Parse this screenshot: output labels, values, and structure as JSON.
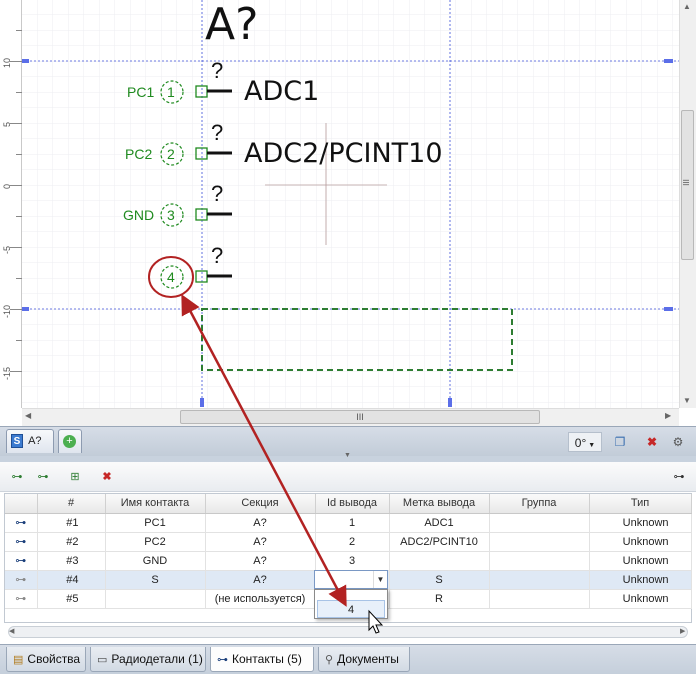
{
  "schematic": {
    "designator": "A?",
    "pins": [
      {
        "net": "PC1",
        "number": "1",
        "name": "ADC1",
        "label": "?"
      },
      {
        "net": "PC2",
        "number": "2",
        "name": "ADC2/PCINT10",
        "label": "?"
      },
      {
        "net": "GND",
        "number": "3",
        "name": "",
        "label": "?"
      },
      {
        "net": "",
        "number": "4",
        "name": "",
        "label": "?"
      }
    ]
  },
  "ruler": {
    "labels": [
      "10",
      "5",
      "0",
      "-5",
      "-10",
      "-15"
    ]
  },
  "scroll": {
    "grip": "III"
  },
  "doc_tab": {
    "label": "A?",
    "icon_letter": "S"
  },
  "toolbar_right": {
    "rotation": "0°"
  },
  "grid": {
    "columns": [
      "#",
      "Имя контакта",
      "Секция",
      "Id вывода",
      "Метка вывода",
      "Группа",
      "Тип"
    ],
    "rows": [
      {
        "num": "#1",
        "name": "PC1",
        "section": "A?",
        "pin_id": "1",
        "pin_label": "ADC1",
        "group": "",
        "type": "Unknown"
      },
      {
        "num": "#2",
        "name": "PC2",
        "section": "A?",
        "pin_id": "2",
        "pin_label": "ADC2/PCINT10",
        "group": "",
        "type": "Unknown"
      },
      {
        "num": "#3",
        "name": "GND",
        "section": "A?",
        "pin_id": "3",
        "pin_label": "",
        "group": "",
        "type": "Unknown"
      },
      {
        "num": "#4",
        "name": "S",
        "section": "A?",
        "pin_id": "",
        "pin_label": "S",
        "group": "",
        "type": "Unknown"
      },
      {
        "num": "#5",
        "name": "",
        "section": "(не используется)",
        "pin_id": "",
        "pin_label": "R",
        "group": "",
        "type": "Unknown"
      }
    ],
    "dropdown_option": "4"
  },
  "bottom_tabs": [
    "Свойства",
    "Радиодетали (1)",
    "Контакты (5)",
    "Документы"
  ],
  "colors": {
    "net_green": "#1f8a1f",
    "highlight_red": "#b22222",
    "selection_box": "#2e7d32",
    "guide_blue": "#3b4fd8"
  }
}
